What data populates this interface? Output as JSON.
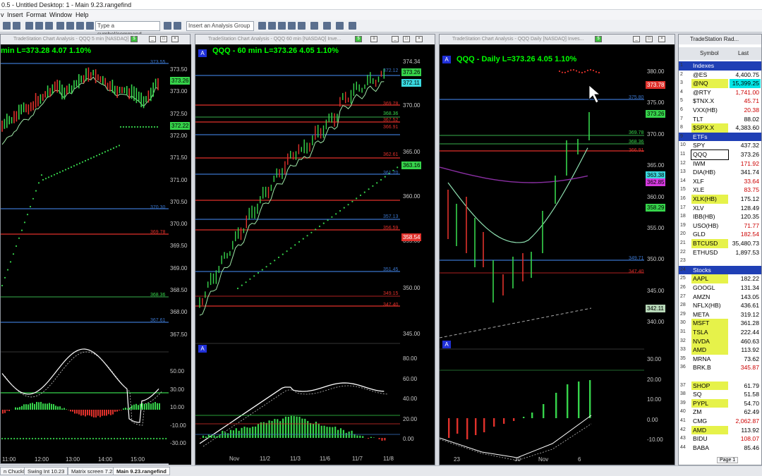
{
  "app": {
    "title": "0.5 - Untitled Desktop: 1 - Main 9.23.rangefind",
    "menu": [
      "Insert",
      "Format",
      "Window",
      "Help"
    ]
  },
  "toolbar": {
    "symbol_placeholder": "Type a symbol/command",
    "analysis_placeholder": "Insert an Analysis Group"
  },
  "chart1": {
    "window_title": "TradeStation Chart Analysis - QQQ 5 min [NASDAQ]",
    "header": "min  L=373.28  4.07  1.10%",
    "price_axis": [
      "373.50",
      "373.00",
      "372.50",
      "372.00",
      "371.50",
      "371.00",
      "370.50",
      "370.00",
      "369.50",
      "369.00",
      "368.50",
      "368.00",
      "367.50"
    ],
    "ind_axis": [
      "50.00",
      "30.00",
      "10.00",
      "-10.00",
      "-30.00"
    ],
    "time_axis": [
      "11:00",
      "12:00",
      "13:00",
      "14:00",
      "15:00"
    ],
    "badges": [
      "373.26",
      "372.22"
    ],
    "line_labels": [
      "373.55",
      "370.30",
      "369.78",
      "368.36",
      "367.61"
    ]
  },
  "chart2": {
    "window_title": "TradeStation Chart Analysis - QQQ 60 min [NASDAQ] Inve...",
    "header": "QQQ - 60 min  L=373.26  4.05  1.10%",
    "price_axis": [
      "374.34",
      "370.00",
      "365.00",
      "360.00",
      "355.00",
      "350.00",
      "345.00"
    ],
    "ind_axis": [
      "80.00",
      "60.00",
      "40.00",
      "20.00",
      "0.00"
    ],
    "time_axis": [
      "Nov",
      "11/2",
      "11/3",
      "11/6",
      "11/7",
      "11/8"
    ],
    "badges": [
      "373.26",
      "372.11",
      "363.16",
      "358.54"
    ],
    "line_labels": [
      "372.12",
      "369.78",
      "368.36",
      "367.52",
      "366.91",
      "362.61",
      "361.70",
      "357.13",
      "356.59",
      "351.45",
      "349.15",
      "347.40"
    ]
  },
  "chart3": {
    "window_title": "TradeStation Chart Analysis - QQQ Daily [NASDAQ] Inves...",
    "header": "QQQ - Daily  L=373.26  4.05  1.10%",
    "price_axis": [
      "380.00",
      "375.00",
      "370.00",
      "365.00",
      "360.00",
      "355.00",
      "350.00",
      "345.00",
      "340.00"
    ],
    "ind_axis": [
      "30.00",
      "20.00",
      "10.00",
      "0.00",
      "-10.00"
    ],
    "time_axis": [
      "23",
      "30",
      "Nov",
      "6"
    ],
    "badges": [
      "373.78",
      "373.26",
      "363.38",
      "362.85",
      "358.29",
      "342.11"
    ],
    "line_labels": [
      "375.80",
      "369.78",
      "368.36",
      "366.91",
      "349.71",
      "347.40"
    ]
  },
  "radar": {
    "title": "TradeStation Rad...",
    "col_symbol": "Symbol",
    "col_last": "Last",
    "rows": [
      {
        "n": "1",
        "sym": "Indexes",
        "last": "",
        "group": true
      },
      {
        "n": "2",
        "sym": "@ES",
        "last": "4,400.75",
        "hl": ""
      },
      {
        "n": "3",
        "sym": "@NQ",
        "last": "15,399.25",
        "hl": "yellow"
      },
      {
        "n": "4",
        "sym": "@RTY",
        "last": "1,741.00",
        "hl": "red"
      },
      {
        "n": "5",
        "sym": "$TNX.X",
        "last": "45.71",
        "hl": "red"
      },
      {
        "n": "6",
        "sym": "VXX(HB)",
        "last": "20.38",
        "hl": "red"
      },
      {
        "n": "7",
        "sym": "TLT",
        "last": "88.02",
        "hl": ""
      },
      {
        "n": "8",
        "sym": "$SPX.X",
        "last": "4,383.60",
        "hl": "yellow"
      },
      {
        "n": "9",
        "sym": "ETFs",
        "last": "",
        "group": true
      },
      {
        "n": "10",
        "sym": "SPY",
        "last": "437.32",
        "hl": ""
      },
      {
        "n": "11",
        "sym": "QQQ",
        "last": "373.26",
        "hl": "sel"
      },
      {
        "n": "12",
        "sym": "IWM",
        "last": "171.92",
        "hl": "red"
      },
      {
        "n": "13",
        "sym": "DIA(HB)",
        "last": "341.74",
        "hl": ""
      },
      {
        "n": "14",
        "sym": "XLF",
        "last": "33.64",
        "hl": "red"
      },
      {
        "n": "15",
        "sym": "XLE",
        "last": "83.75",
        "hl": "red"
      },
      {
        "n": "16",
        "sym": "XLK(HB)",
        "last": "175.12",
        "hl": "yellow"
      },
      {
        "n": "17",
        "sym": "XLV",
        "last": "128.49",
        "hl": ""
      },
      {
        "n": "18",
        "sym": "IBB(HB)",
        "last": "120.35",
        "hl": ""
      },
      {
        "n": "19",
        "sym": "USO(HB)",
        "last": "71.77",
        "hl": "red"
      },
      {
        "n": "20",
        "sym": "GLD",
        "last": "182.54",
        "hl": "red"
      },
      {
        "n": "21",
        "sym": "BTCUSD",
        "last": "35,480.73",
        "hl": "yellow"
      },
      {
        "n": "22",
        "sym": "ETHUSD",
        "last": "1,897.53",
        "hl": ""
      },
      {
        "n": "23",
        "sym": "",
        "last": "",
        "hl": ""
      },
      {
        "n": "24",
        "sym": "Stocks",
        "last": "",
        "group": true
      },
      {
        "n": "25",
        "sym": "AAPL",
        "last": "182.22",
        "hl": "yellow"
      },
      {
        "n": "26",
        "sym": "GOOGL",
        "last": "131.34",
        "hl": ""
      },
      {
        "n": "27",
        "sym": "AMZN",
        "last": "143.05",
        "hl": ""
      },
      {
        "n": "28",
        "sym": "NFLX(HB)",
        "last": "436.61",
        "hl": ""
      },
      {
        "n": "29",
        "sym": "META",
        "last": "319.12",
        "hl": ""
      },
      {
        "n": "30",
        "sym": "MSFT",
        "last": "361.28",
        "hl": "yellow"
      },
      {
        "n": "31",
        "sym": "TSLA",
        "last": "222.44",
        "hl": "yellow"
      },
      {
        "n": "32",
        "sym": "NVDA",
        "last": "460.63",
        "hl": "yellow"
      },
      {
        "n": "33",
        "sym": "AMD",
        "last": "113.92",
        "hl": "yellow"
      },
      {
        "n": "35",
        "sym": "MRNA",
        "last": "73.62",
        "hl": ""
      },
      {
        "n": "36",
        "sym": "BRK.B",
        "last": "345.87",
        "hl": "red"
      },
      {
        "n": "",
        "sym": "",
        "last": "",
        "hl": ""
      },
      {
        "n": "37",
        "sym": "SHOP",
        "last": "61.79",
        "hl": "yellow"
      },
      {
        "n": "38",
        "sym": "SQ",
        "last": "51.58",
        "hl": ""
      },
      {
        "n": "39",
        "sym": "PYPL",
        "last": "54.70",
        "hl": "yellow"
      },
      {
        "n": "40",
        "sym": "ZM",
        "last": "62.49",
        "hl": ""
      },
      {
        "n": "41",
        "sym": "CMG",
        "last": "2,062.87",
        "hl": "red"
      },
      {
        "n": "42",
        "sym": "AMD",
        "last": "113.92",
        "hl": "yellow"
      },
      {
        "n": "43",
        "sym": "BIDU",
        "last": "108.07",
        "hl": "red"
      },
      {
        "n": "44",
        "sym": "BABA",
        "last": "85.46",
        "hl": ""
      }
    ],
    "page_tab": "Page 1"
  },
  "tabs": [
    {
      "label": "n ChuckH",
      "active": false
    },
    {
      "label": "Swing Int 10.23",
      "active": false
    },
    {
      "label": "Matrix screen 7.23",
      "active": false
    },
    {
      "label": "Main 9.23.rangefind",
      "active": true
    }
  ],
  "colors": {
    "bg": "#000000",
    "up": "#36d44b",
    "down": "#e0312b",
    "ma": "#9ee6a6",
    "highlight_yellow": "#e6f24a",
    "group": "#1f3fb5"
  }
}
